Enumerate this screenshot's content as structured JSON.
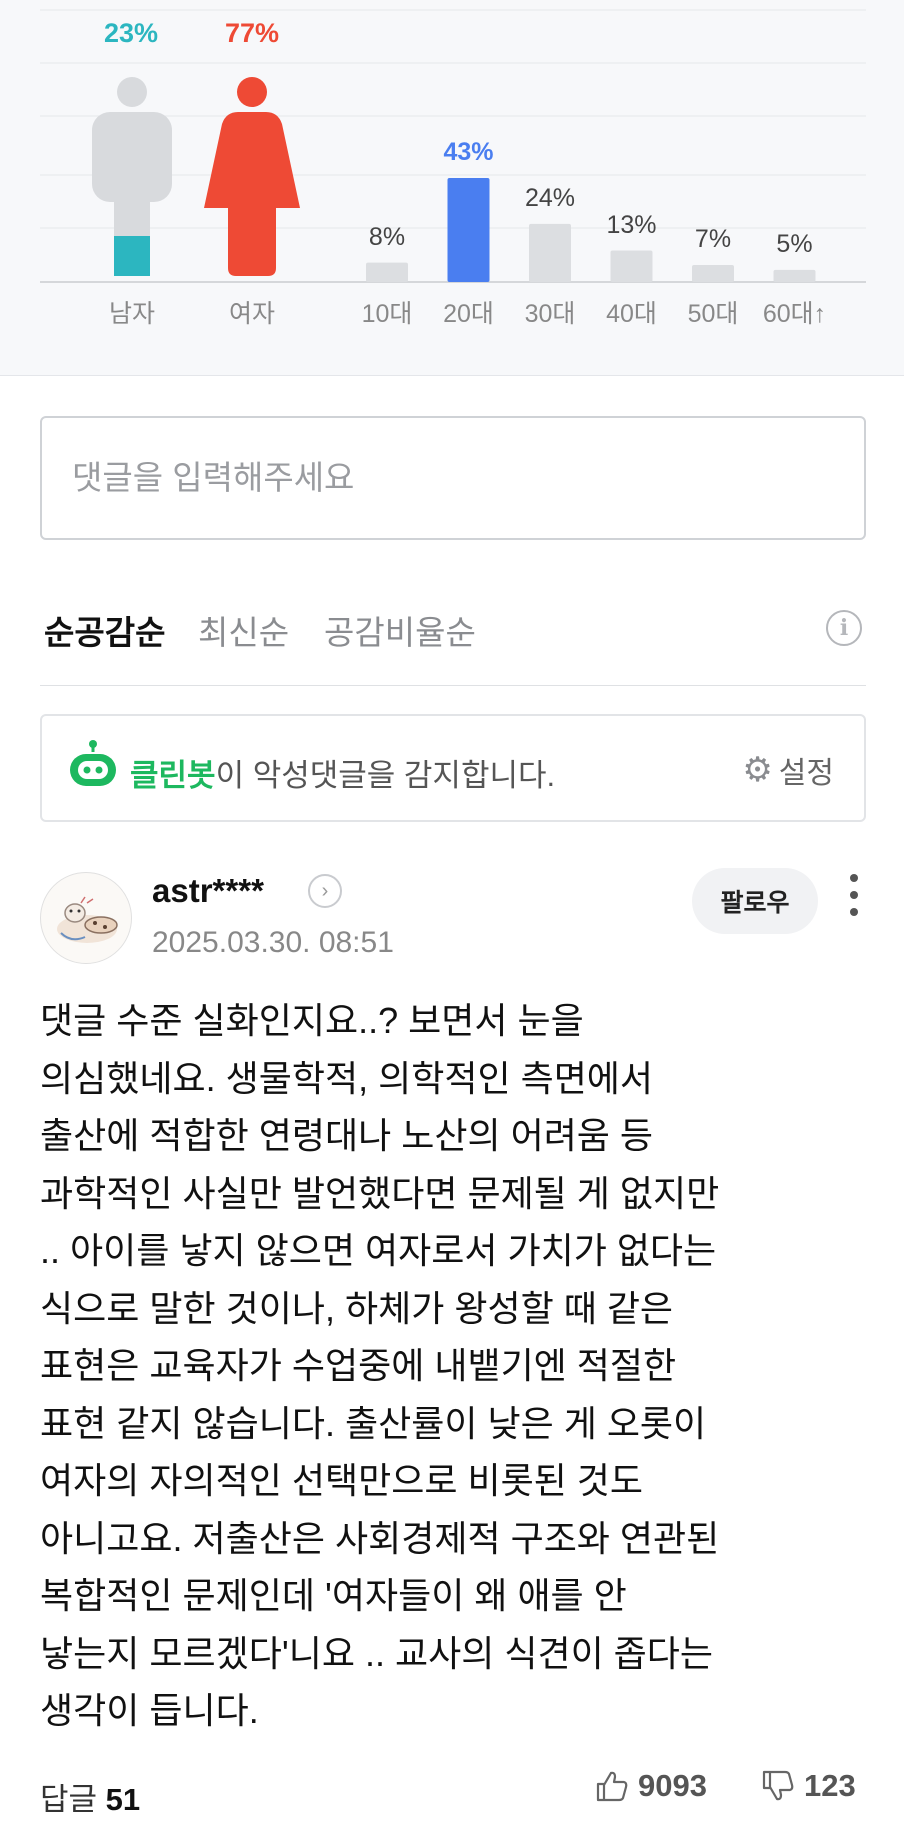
{
  "stats": {
    "gender": [
      {
        "label": "남자",
        "percent_text": "23%",
        "value": 23,
        "color": "#2cb6c0"
      },
      {
        "label": "여자",
        "percent_text": "77%",
        "value": 77,
        "color": "#ee4a35"
      }
    ],
    "age": {
      "accent_color": "#4a7ef0",
      "categories": [
        "10대",
        "20대",
        "30대",
        "40대",
        "50대",
        "60대↑"
      ],
      "values": [
        8,
        43,
        24,
        13,
        7,
        5
      ],
      "percent_texts": [
        "8%",
        "43%",
        "24%",
        "13%",
        "7%",
        "5%"
      ],
      "highlight_index": 1
    }
  },
  "comment_input": {
    "placeholder": "댓글을 입력해주세요"
  },
  "sort_tabs": [
    {
      "label": "순공감순",
      "active": true
    },
    {
      "label": "최신순",
      "active": false
    },
    {
      "label": "공감비율순",
      "active": false
    }
  ],
  "info_icon": {
    "glyph": "i"
  },
  "cleanbot": {
    "name": "클린봇",
    "message": "이 악성댓글을 감지합니다.",
    "settings_label": "설정",
    "brand_color": "#1db85f"
  },
  "comment": {
    "author": "astr****",
    "timestamp": "2025.03.30. 08:51",
    "follow_label": "팔로우",
    "lines": [
      "댓글 수준 실화인지요..? 보면서 눈을",
      "의심했네요. 생물학적, 의학적인 측면에서",
      "출산에 적합한 연령대나 노산의 어려움 등",
      "과학적인 사실만 발언했다면 문제될 게 없지만",
      ".. 아이를 낳지 않으면 여자로서 가치가 없다는",
      "식으로 말한 것이나, 하체가 왕성할 때 같은",
      "표현은 교육자가 수업중에 내뱉기엔 적절한",
      "표현 같지 않습니다. 출산률이 낮은 게 오롯이",
      "여자의 자의적인 선택만으로 비롯된 것도",
      "아니고요. 저출산은 사회경제적 구조와 연관된",
      "복합적인 문제인데 '여자들이 왜 애를 안",
      "낳는지 모르겠다'니요 .. 교사의 식견이 좁다는",
      "생각이 듭니다."
    ],
    "reply_label": "답글",
    "reply_count": "51",
    "like_count": "9093",
    "dislike_count": "123"
  }
}
